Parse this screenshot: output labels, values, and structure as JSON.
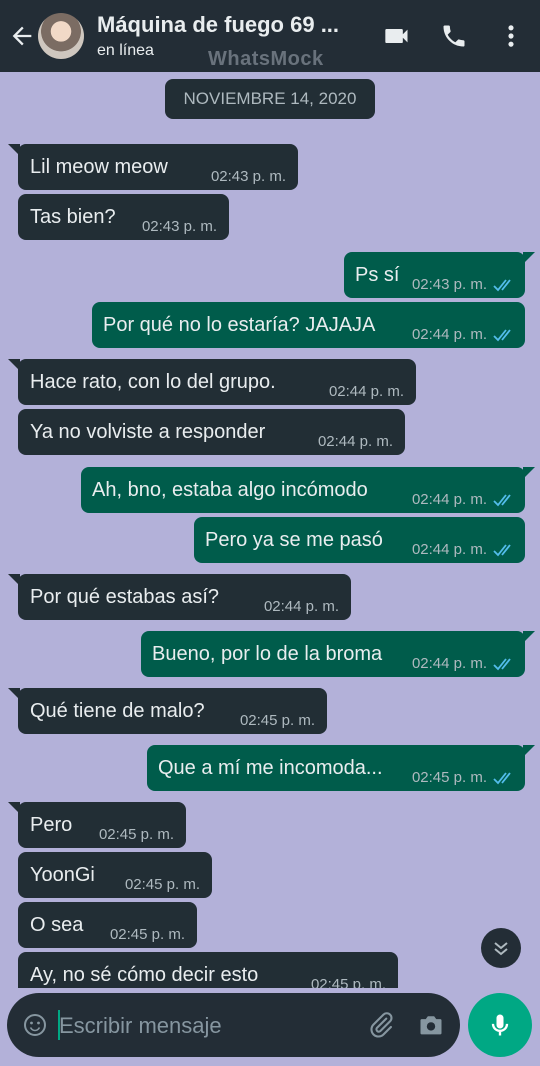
{
  "header": {
    "title": "Máquina de fuego 69 ...",
    "status": "en línea",
    "watermark": "WhatsMock",
    "icons": [
      "back-arrow-icon",
      "video-call-icon",
      "phone-icon",
      "more-vert-icon"
    ]
  },
  "date_chip": "NOVIEMBRE 14, 2020",
  "colors": {
    "wallpaper": "#b3b1d9",
    "incoming_bubble": "#222e35",
    "outgoing_bubble": "#005c4b",
    "read_ticks": "#53bdeb",
    "accent": "#00a884"
  },
  "messages": [
    {
      "dir": "in",
      "text": "Lil meow meow",
      "time": "02:43 p. m."
    },
    {
      "dir": "in",
      "text": "Tas bien?",
      "time": "02:43 p. m."
    },
    {
      "dir": "out",
      "text": "Ps sí",
      "time": "02:43 p. m.",
      "status": "read"
    },
    {
      "dir": "out",
      "text": "Por qué no lo estaría? JAJAJA",
      "time": "02:44 p. m.",
      "status": "read"
    },
    {
      "dir": "in",
      "text": "Hace rato, con lo del grupo.",
      "time": "02:44 p. m."
    },
    {
      "dir": "in",
      "text": "Ya no volviste a responder",
      "time": "02:44 p. m."
    },
    {
      "dir": "out",
      "text": "Ah, bno, estaba algo incómodo",
      "time": "02:44 p. m.",
      "status": "read"
    },
    {
      "dir": "out",
      "text": "Pero ya se me pasó",
      "time": "02:44 p. m.",
      "status": "read"
    },
    {
      "dir": "in",
      "text": "Por qué estabas así?",
      "time": "02:44 p. m."
    },
    {
      "dir": "out",
      "text": "Bueno, por lo de la broma",
      "time": "02:44 p. m.",
      "status": "read"
    },
    {
      "dir": "in",
      "text": "Qué tiene de malo?",
      "time": "02:45 p. m."
    },
    {
      "dir": "out",
      "text": "Que a mí me incomoda...",
      "time": "02:45 p. m.",
      "status": "read"
    },
    {
      "dir": "in",
      "text": "Pero",
      "time": "02:45 p. m."
    },
    {
      "dir": "in",
      "text": "YoonGi",
      "time": "02:45 p. m."
    },
    {
      "dir": "in",
      "text": "O sea",
      "time": "02:45 p. m."
    },
    {
      "dir": "in",
      "text": "Ay, no sé cómo decir esto",
      "time": "02:45 p. m."
    }
  ],
  "composer": {
    "placeholder": "Escribir mensaje",
    "value": "",
    "icons": [
      "emoji-icon",
      "attach-icon",
      "camera-icon",
      "mic-icon",
      "scroll-down-icon"
    ]
  }
}
